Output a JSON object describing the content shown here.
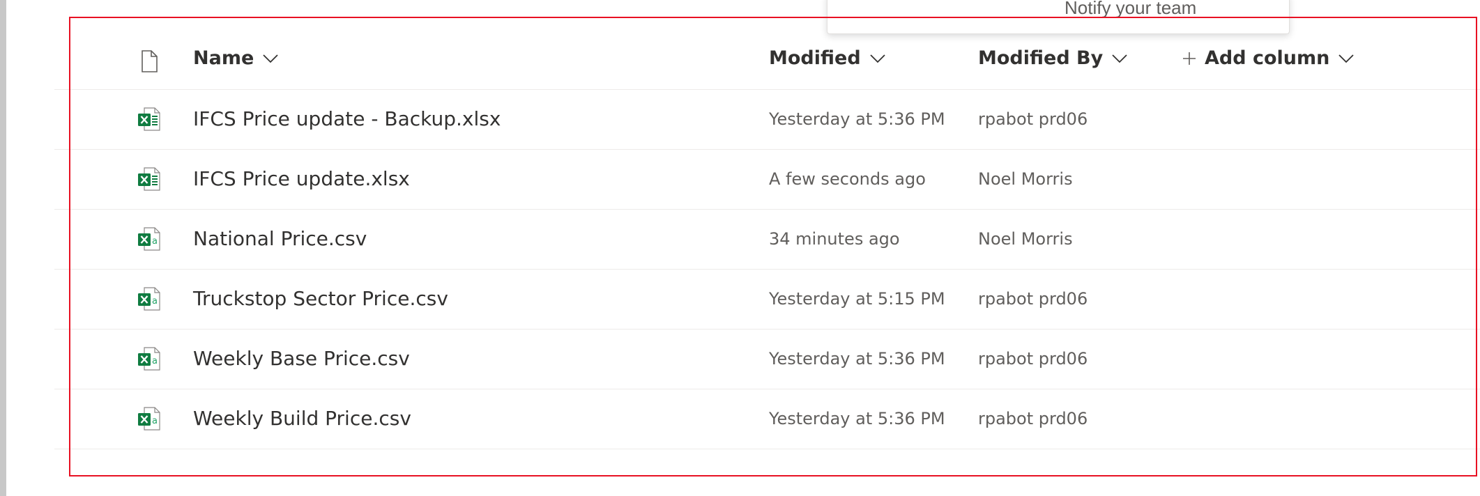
{
  "popup": {
    "text": "Notify your team"
  },
  "columns": {
    "name": "Name",
    "modified": "Modified",
    "modified_by": "Modified By",
    "add_column": "Add column"
  },
  "files": [
    {
      "name": "IFCS Price update - Backup.xlsx",
      "icon": "excel-workbook-icon",
      "modified": "Yesterday at 5:36 PM",
      "modified_by": "rpabot prd06"
    },
    {
      "name": "IFCS Price update.xlsx",
      "icon": "excel-workbook-icon",
      "modified": "A few seconds ago",
      "modified_by": "Noel Morris"
    },
    {
      "name": "National Price.csv",
      "icon": "csv-file-icon",
      "modified": "34 minutes ago",
      "modified_by": "Noel Morris"
    },
    {
      "name": "Truckstop Sector Price.csv",
      "icon": "csv-file-icon",
      "modified": "Yesterday at 5:15 PM",
      "modified_by": "rpabot prd06"
    },
    {
      "name": "Weekly Base Price.csv",
      "icon": "csv-file-icon",
      "modified": "Yesterday at 5:36 PM",
      "modified_by": "rpabot prd06"
    },
    {
      "name": "Weekly Build Price.csv",
      "icon": "csv-file-icon",
      "modified": "Yesterday at 5:36 PM",
      "modified_by": "rpabot prd06"
    }
  ],
  "colors": {
    "excel_green": "#107c41",
    "selection_border": "#e81123",
    "divider": "#edebe9"
  }
}
